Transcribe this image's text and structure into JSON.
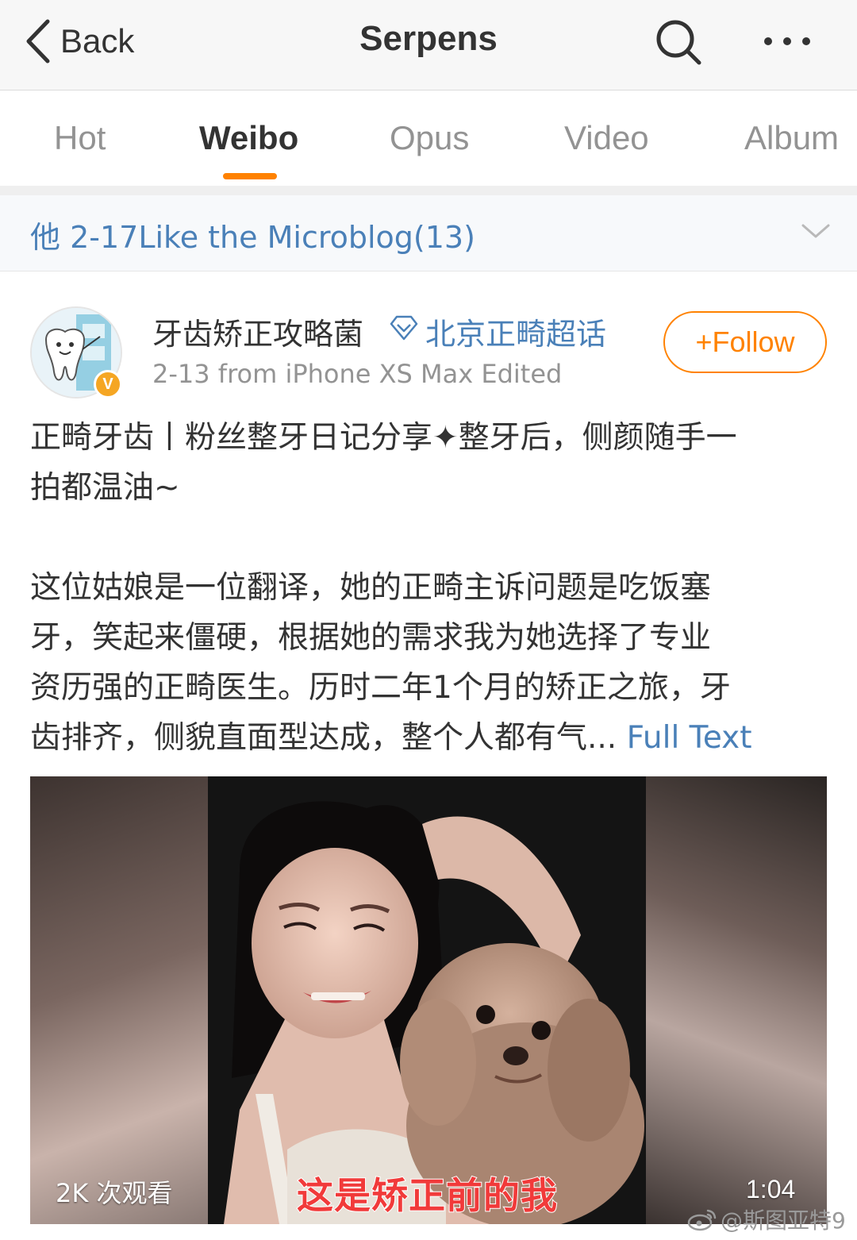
{
  "navbar": {
    "back_label": "Back",
    "title": "Serpens",
    "back_icon": "chevron-left-icon",
    "search_icon": "search-icon",
    "more_icon": "more-dots-icon"
  },
  "tabs": [
    {
      "label": "Hot",
      "active": false
    },
    {
      "label": "Weibo",
      "active": true
    },
    {
      "label": "Opus",
      "active": false
    },
    {
      "label": "Video",
      "active": false
    },
    {
      "label": "Album",
      "active": false
    }
  ],
  "like_banner": {
    "text": "他 2-17Like the Microblog(13)",
    "icon": "chevron-down-icon"
  },
  "post": {
    "username": "牙齿矫正攻略菌",
    "topic": "北京正畸超话",
    "topic_icon": "diamond-icon",
    "meta": "2-13  from iPhone XS Max  Edited",
    "follow_label": "+Follow",
    "verified_badge": "V",
    "text_lines": [
      "正畸牙齿丨粉丝整牙日记分享✦整牙后，侧颜随手一",
      "拍都温油~",
      "",
      "这位姑娘是一位翻译，她的正畸主诉问题是吃饭塞",
      "牙，笑起来僵硬，根据她的需求我为她选择了专业",
      "资历强的正畸医生。历时二年1个月的矫正之旅，牙",
      "齿排齐，侧貌直面型达成，整个人都有气... "
    ],
    "full_text_label": "Full Text"
  },
  "video": {
    "views": "2K 次观看",
    "caption": "这是矫正前的我",
    "duration": "1:04"
  },
  "watermark": {
    "text": "@斯图亚特9",
    "icon": "weibo-logo-icon"
  },
  "colors": {
    "accent_orange": "#ff8200",
    "link_blue": "#4a80b8",
    "muted_gray": "#939393",
    "nav_bg": "#f7f7f7"
  }
}
